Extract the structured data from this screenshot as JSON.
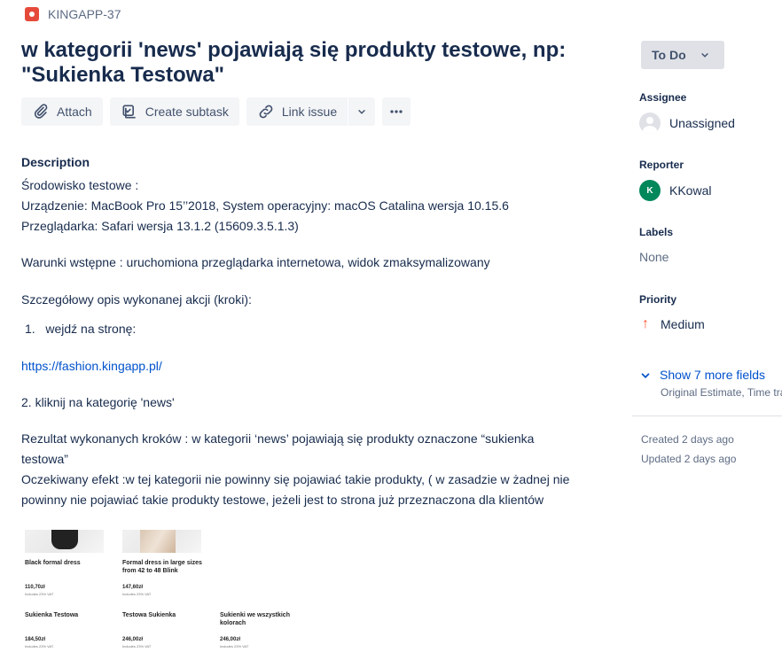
{
  "issue": {
    "key": "KINGAPP-37",
    "title": "w kategorii 'news' pojawiają się produkty testowe, np: \"Sukienka Testowa\""
  },
  "toolbar": {
    "attach_label": "Attach",
    "subtask_label": "Create subtask",
    "link_label": "Link issue"
  },
  "description": {
    "heading": "Description",
    "lines": [
      "Środowisko testowe :",
      "Urządzenie: MacBook Pro 15’’2018, System operacyjny: macOS Catalina wersja 10.15.6",
      "Przeglądarka: Safari wersja 13.1.2 (15609.3.5.1.3)",
      "Warunki wstępne : uruchomiona przeglądarka internetowa, widok zmaksymalizowany",
      "Szczegółowy opis wykonanej akcji (kroki):",
      "1.   wejdź na stronę:",
      "https://fashion.kingapp.pl/",
      "2. kliknij na kategorię 'news'",
      "Rezultat wykonanych kroków : w kategorii ‘news’ pojawiają się produkty oznaczone “sukienka",
      "testowa”",
      "Oczekiwany efekt :w tej kategorii nie powinny się pojawiać takie produkty, ( w zasadzie w żadnej nie",
      "powinny nie pojawiać takie produkty testowe, jeżeli jest to strona już przeznaczona dla klientów"
    ]
  },
  "screenshot": {
    "products": [
      {
        "name": "Black formal dress",
        "price": "110,70zł",
        "vat": "Includes 23% VAT"
      },
      {
        "name": "Formal dress in large sizes from 42 to 48 Blink",
        "price": "147,60zł",
        "vat": "Includes 23% VAT"
      },
      {
        "name": "Sukienka Testowa",
        "price": "184,50zł",
        "vat": "Includes 23% VAT"
      },
      {
        "name": "Testowa Sukienka",
        "price": "246,00zł",
        "vat": "Includes 23% VAT"
      },
      {
        "name": "Sukienki we wszystkich kolorach",
        "price": "246,00zł",
        "vat": "Includes 23% VAT"
      }
    ]
  },
  "sidebar": {
    "status": "To Do",
    "assignee_label": "Assignee",
    "assignee_value": "Unassigned",
    "reporter_label": "Reporter",
    "reporter_value": "KKowal",
    "reporter_initial": "K",
    "labels_label": "Labels",
    "labels_value": "None",
    "priority_label": "Priority",
    "priority_value": "Medium",
    "show_more": "Show 7 more fields",
    "show_more_sub": "Original Estimate, Time tracking",
    "created": "Created 2 days ago",
    "updated": "Updated 2 days ago"
  },
  "colors": {
    "link": "#0052cc",
    "reporter_avatar": "#00875a",
    "priority_medium": "#ff5630",
    "bug": "#e5493a"
  }
}
